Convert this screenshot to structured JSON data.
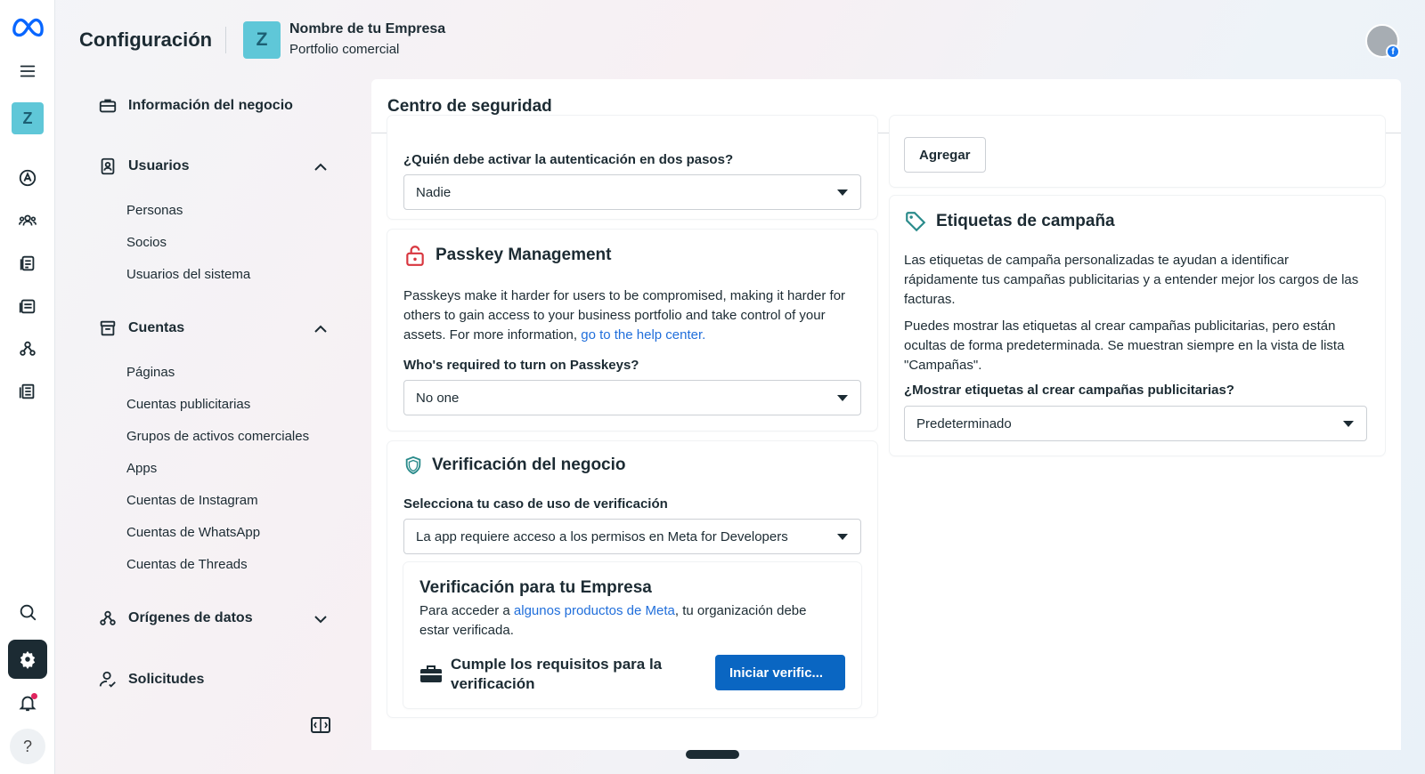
{
  "app": {
    "page_title": "Configuración",
    "company_initial": "Z",
    "company_name": "Nombre de tu Empresa",
    "company_subtitle": "Portfolio comercial",
    "rail_initial": "Z",
    "help_glyph": "?"
  },
  "sidebar": {
    "business_info": "Información del negocio",
    "users": {
      "label": "Usuarios",
      "items": [
        "Personas",
        "Socios",
        "Usuarios del sistema"
      ]
    },
    "accounts": {
      "label": "Cuentas",
      "items": [
        "Páginas",
        "Cuentas publicitarias",
        "Grupos de activos comerciales",
        "Apps",
        "Cuentas de Instagram",
        "Cuentas de WhatsApp",
        "Cuentas de Threads"
      ]
    },
    "data_sources": "Orígenes de datos",
    "requests": "Solicitudes"
  },
  "main": {
    "title": "Centro de seguridad",
    "two_step": {
      "label": "¿Quién debe activar la autenticación en dos pasos?",
      "value": "Nadie"
    },
    "passkey": {
      "title": "Passkey Management",
      "description": "Passkeys make it harder for users to be compromised, making it harder for others to gain access to your business portfolio and take control of your assets. For more information, ",
      "link": "go to the help center.",
      "label": "Who's required to turn on Passkeys?",
      "value": "No one"
    },
    "verification": {
      "title": "Verificación del negocio",
      "label": "Selecciona tu caso de uso de verificación",
      "value": "La app requiere acceso a los permisos en Meta for Developers",
      "box_title": "Verificación para tu Empresa",
      "box_text_before": "Para acceder a ",
      "box_link": "algunos productos de Meta",
      "box_text_after": ", tu organización debe estar verificada.",
      "requirement": "Cumple los requisitos para la verificación",
      "button": "Iniciar verific..."
    },
    "add_button": "Agregar",
    "campaign_tags": {
      "title": "Etiquetas de campaña",
      "p1": "Las etiquetas de campaña personalizadas te ayudan a identificar rápidamente tus campañas publicitarias y a entender mejor los cargos de las facturas.",
      "p2": "Puedes mostrar las etiquetas al crear campañas publicitarias, pero están ocultas de forma predeterminada. Se muestran siempre en la vista de lista \"Campañas\".",
      "label": "¿Mostrar etiquetas al crear campañas publicitarias?",
      "value": "Predeterminado"
    }
  },
  "colors": {
    "accent": "#0a66c2",
    "link": "#216fdb",
    "brand_tile": "#5fc7d8",
    "text": "#1c2b33"
  }
}
